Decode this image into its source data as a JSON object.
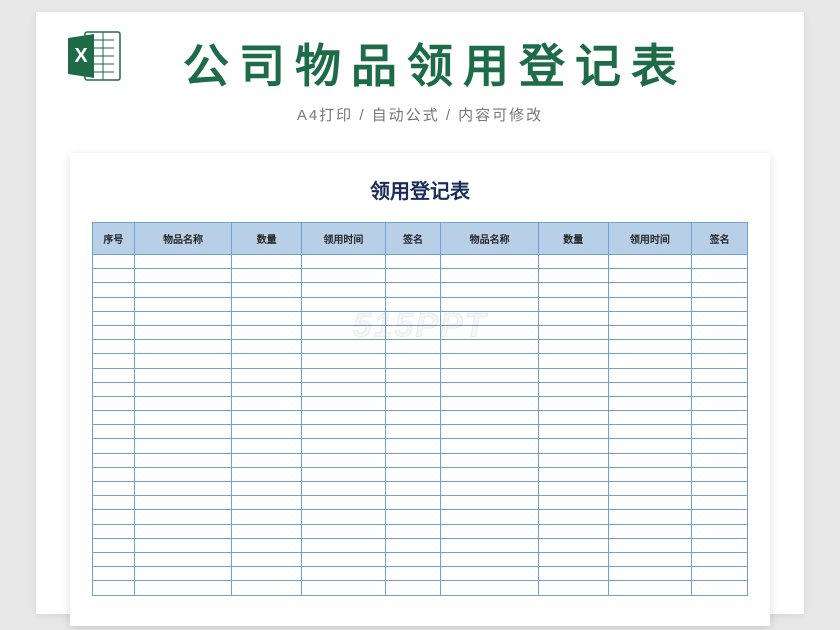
{
  "header": {
    "title": "公司物品领用登记表",
    "subtitle": "A4打印 / 自动公式 / 内容可修改",
    "icon_letter": "X"
  },
  "sheet": {
    "title": "领用登记表",
    "watermark": "515PPT",
    "columns": [
      "序号",
      "物品名称",
      "数量",
      "领用时间",
      "签名",
      "物品名称",
      "数量",
      "领用时间",
      "签名"
    ],
    "row_count": 24
  },
  "colors": {
    "title_green": "#1e6b47",
    "header_blue": "#b8cfe8",
    "border_blue": "#6fa0d6",
    "sheet_title": "#1a2d5a"
  }
}
